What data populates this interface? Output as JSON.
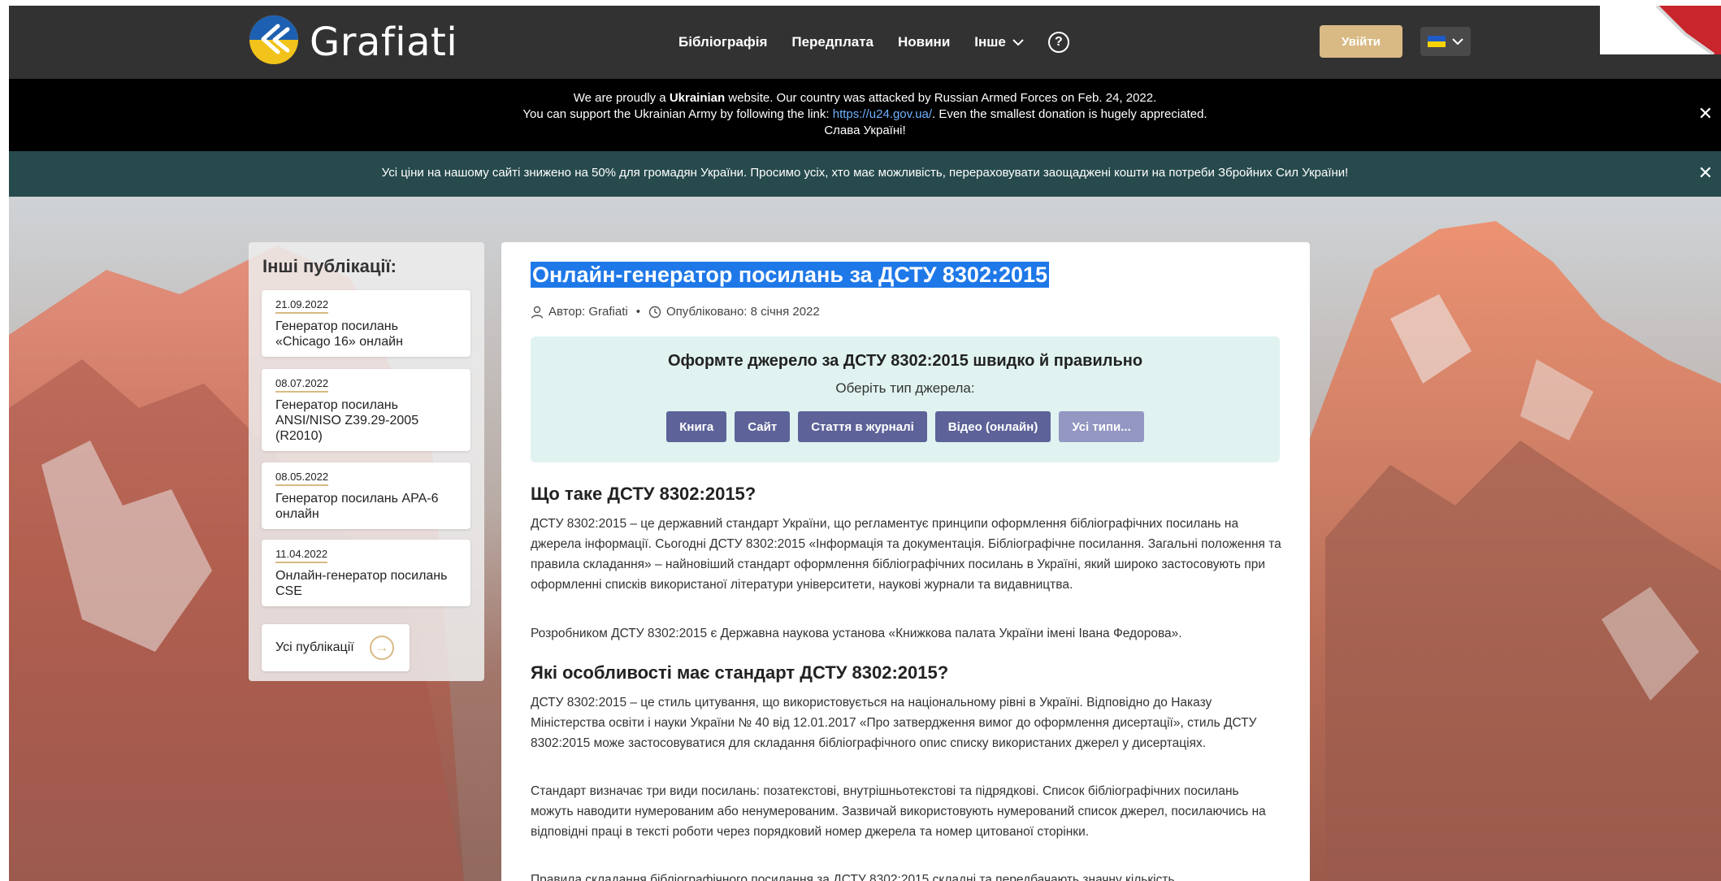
{
  "brand": {
    "name": "Grafiati"
  },
  "nav": {
    "items": [
      "Бібліографія",
      "Передплата",
      "Новини",
      "Інше"
    ]
  },
  "header": {
    "login_label": "Увійти"
  },
  "banner": {
    "line1_pre": "We are proudly a ",
    "line1_bold": "Ukrainian",
    "line1_post": " website. Our country was attacked by Russian Armed Forces on Feb. 24, 2022.",
    "line2_pre": "You can support the Ukrainian Army by following the link: ",
    "line2_link": "https://u24.gov.ua/",
    "line2_post": ". Even the smallest donation is hugely appreciated.",
    "line3": "Слава Україні!",
    "close": "✕"
  },
  "notice": {
    "text": "Усі ціни на нашому сайті знижено на 50% для громадян України. Просимо усіх, хто має можливість, перераховувати заощаджені кошти на потреби Збройних Сил України!",
    "close": "✕"
  },
  "sidebar": {
    "title": "Інші публікації:",
    "items": [
      {
        "date": "21.09.2022",
        "title": "Генератор посилань «Chicago 16» онлайн"
      },
      {
        "date": "08.07.2022",
        "title": "Генератор посилань ANSI/NISO Z39.29-2005 (R2010)"
      },
      {
        "date": "08.05.2022",
        "title": "Генератор посилань APA-6 онлайн"
      },
      {
        "date": "11.04.2022",
        "title": "Онлайн-генератор посилань CSE"
      }
    ],
    "all_label": "Усі публікації"
  },
  "article": {
    "title": "Онлайн-генератор посилань за ДСТУ 8302:2015",
    "author": "Автор: Grafiati",
    "separator": "•",
    "published": "Опубліковано: 8 січня 2022",
    "cta": {
      "title": "Оформте джерело за ДСТУ 8302:2015 швидко й правильно",
      "subtitle": "Оберіть тип джерела:",
      "buttons": [
        "Книга",
        "Сайт",
        "Стаття в журналі",
        "Відео (онлайн)",
        "Усі типи..."
      ]
    },
    "h1": "Що таке ДСТУ 8302:2015?",
    "p1": "ДСТУ 8302:2015 – це державний стандарт України, що регламентує принципи оформлення бібліографічних посилань на джерела інформації. Сьогодні ДСТУ 8302:2015 «Інформація та документація. Бібліографічне посилання. Загальні положення та правила складання» – найновіший стандарт оформлення бібліографічних посилань в Україні, який широко застосовують при оформленні списків використаної літератури університети, наукові журнали та видавництва.",
    "p2": "Розробником ДСТУ 8302:2015 є Державна наукова установа «Книжкова палата України імені Івана Федорова».",
    "h2": "Які особливості має стандарт ДСТУ 8302:2015?",
    "p3": "ДСТУ 8302:2015 – це стиль цитування, що використовується на національному рівні в Україні. Відповідно до Наказу Міністерства освіти і науки України № 40 від 12.01.2017 «Про затвердження вимог до оформлення дисертації», стиль ДСТУ 8302:2015 може застосовуватися для складання бібліографічного опис списку використаних джерел у дисертаціях.",
    "p4": "Стандарт визначає три види посилань: позатекстові, внутрішньотекстові та підрядкові. Список бібліографічних посилань можуть наводити нумерованим або ненумерованим. Зазвичай використовують нумерований список джерел, посилаючись на відповідні праці в тексті роботи через порядковий номер джерела та номер цитованої сторінки.",
    "p5": "Правила складання бібліографічного посилання за ДСТУ 8302:2015 складні та передбачають значну кількість"
  },
  "colors": {
    "header_bg": "#333233",
    "accent_gold": "#d9ba84",
    "notice_bg": "#274a4d",
    "button_bg": "#5d6398",
    "cta_bg": "#e0f3f1"
  }
}
